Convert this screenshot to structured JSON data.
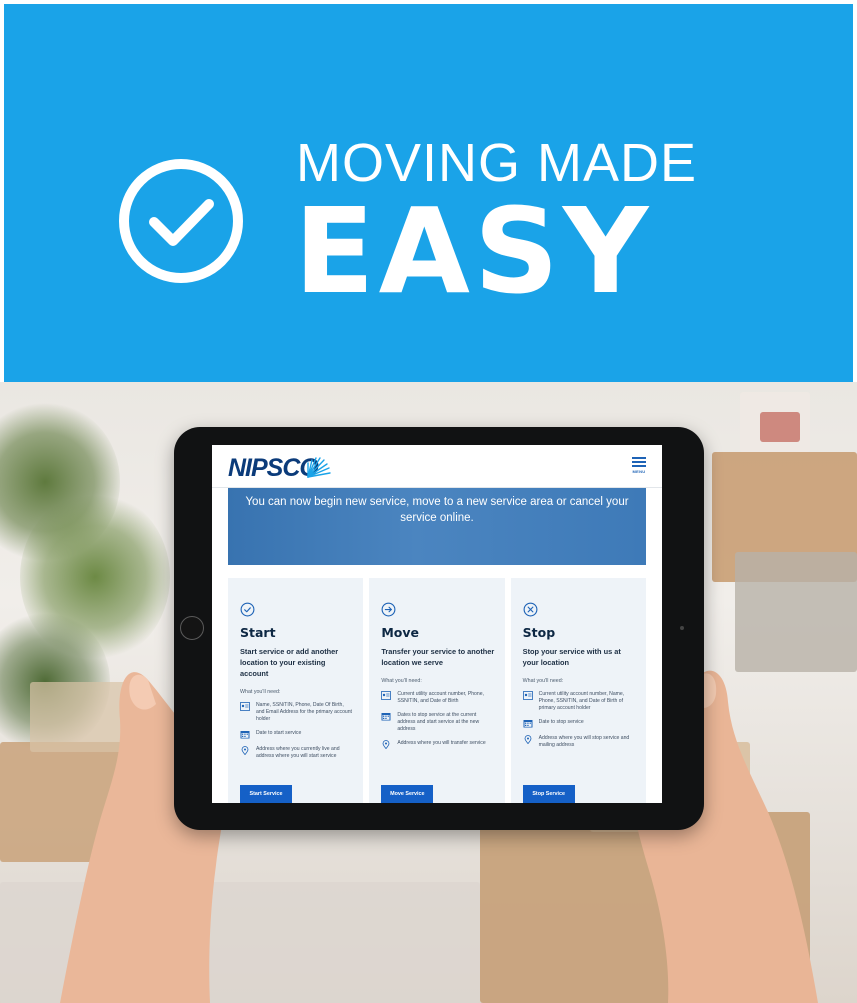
{
  "banner": {
    "headline_small": "MOVING MADE",
    "headline_big": "EASY",
    "icon": "check-circle-icon",
    "background_color": "#1aa3e8"
  },
  "screen": {
    "logo_text": "NIPSCO",
    "menu_label": "MENU",
    "hero_text": "You can now begin new service, move to a new service area or cancel your service online.",
    "cards": [
      {
        "icon": "check-circle-icon",
        "title": "Start",
        "subtitle": "Start service or add another location to your existing account",
        "need_label": "What you'll need:",
        "requirements": [
          {
            "icon": "id-card-icon",
            "text": "Name, SSN/TIN, Phone, Date Of Birth, and Email Address for the primary account holder"
          },
          {
            "icon": "calendar-icon",
            "text": "Date to start service"
          },
          {
            "icon": "location-pin-icon",
            "text": "Address where you currently live and address where you will start service"
          }
        ],
        "button_label": "Start Service"
      },
      {
        "icon": "arrow-circle-icon",
        "title": "Move",
        "subtitle": "Transfer your service to another location we serve",
        "need_label": "What you'll need:",
        "requirements": [
          {
            "icon": "id-card-icon",
            "text": "Current utility account number, Phone, SSN/TIN, and Date of Birth"
          },
          {
            "icon": "calendar-icon",
            "text": "Dates to stop service at the current address and start service at the new address"
          },
          {
            "icon": "location-pin-icon",
            "text": "Address where you will transfer service"
          }
        ],
        "button_label": "Move Service"
      },
      {
        "icon": "x-circle-icon",
        "title": "Stop",
        "subtitle": "Stop your service with us at your location",
        "need_label": "What you'll need:",
        "requirements": [
          {
            "icon": "id-card-icon",
            "text": "Current utility account number, Name, Phone, SSN/TIN, and Date of Birth of primary account holder"
          },
          {
            "icon": "calendar-icon",
            "text": "Date to stop service"
          },
          {
            "icon": "location-pin-icon",
            "text": "Address where you will stop service and mailing address"
          }
        ],
        "button_label": "Stop Service"
      }
    ],
    "colors": {
      "primary_button": "#1560c7",
      "logo": "#0b3b7a",
      "card_background": "#eef3f8"
    }
  }
}
